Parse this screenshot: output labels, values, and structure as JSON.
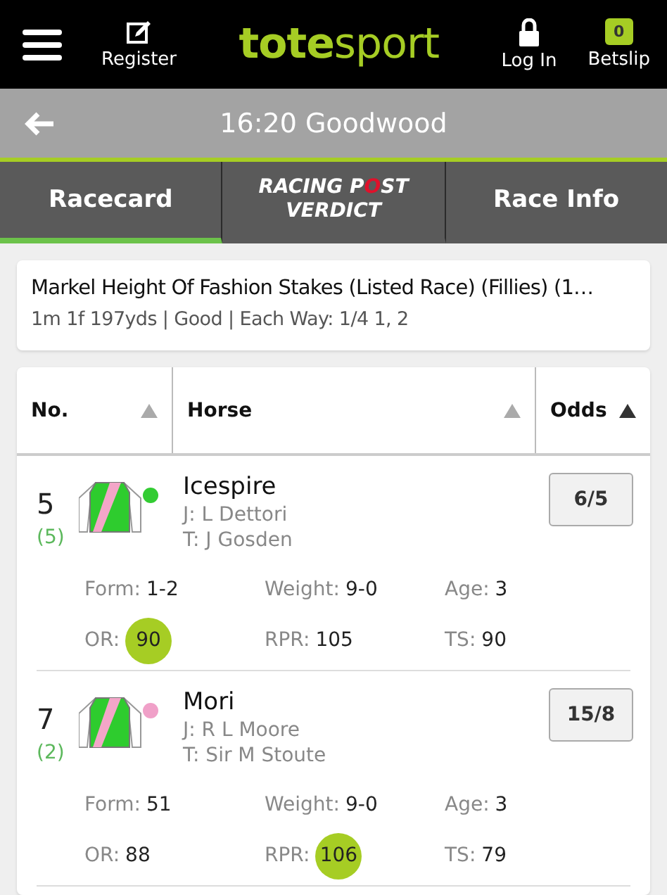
{
  "header": {
    "register": "Register",
    "logo": [
      "tote",
      "sport"
    ],
    "login": "Log In",
    "betslip": "Betslip",
    "betslip_count": "0"
  },
  "title_bar": {
    "title": "16:20 Goodwood"
  },
  "tabs": [
    {
      "kind": "text",
      "label": "Racecard",
      "selected": true
    },
    {
      "kind": "logo",
      "parts": [
        "RACING P",
        "O",
        "ST"
      ],
      "sub": "VERDICT",
      "selected": false
    },
    {
      "kind": "text",
      "label": "Race Info",
      "selected": false
    }
  ],
  "race": {
    "name": "Markel Height Of Fashion Stakes (Listed Race) (Fillies) (1…",
    "details": "1m 1f 197yds | Good | Each Way: 1/4 1, 2"
  },
  "table": {
    "columns": [
      {
        "label": "No.",
        "sorted": false
      },
      {
        "label": "Horse",
        "sorted": false
      },
      {
        "label": "Odds",
        "sorted": true
      }
    ],
    "rows": [
      {
        "number": "5",
        "draw": "(5)",
        "color": "#33cc33",
        "horse": "Icespire",
        "jockey": "J: L Dettori",
        "trainer": "T: J Gosden",
        "odds": "6/5",
        "stats": [
          {
            "label": "Form:",
            "value": "1-2",
            "highlighted": false
          },
          {
            "label": "Weight:",
            "value": "9-0",
            "highlighted": false
          },
          {
            "label": "Age:",
            "value": "3",
            "highlighted": false
          },
          {
            "label": "OR:",
            "value": "90",
            "highlighted": true
          },
          {
            "label": "RPR:",
            "value": "105",
            "highlighted": false
          },
          {
            "label": "TS:",
            "value": "90",
            "highlighted": false
          }
        ]
      },
      {
        "number": "7",
        "draw": "(2)",
        "color": "#f0a0c8",
        "horse": "Mori",
        "jockey": "J: R L Moore",
        "trainer": "T: Sir M Stoute",
        "odds": "15/8",
        "stats": [
          {
            "label": "Form:",
            "value": "51",
            "highlighted": false
          },
          {
            "label": "Weight:",
            "value": "9-0",
            "highlighted": false
          },
          {
            "label": "Age:",
            "value": "3",
            "highlighted": false
          },
          {
            "label": "OR:",
            "value": "88",
            "highlighted": false
          },
          {
            "label": "RPR:",
            "value": "106",
            "highlighted": true
          },
          {
            "label": "TS:",
            "value": "79",
            "highlighted": false
          }
        ]
      }
    ]
  }
}
